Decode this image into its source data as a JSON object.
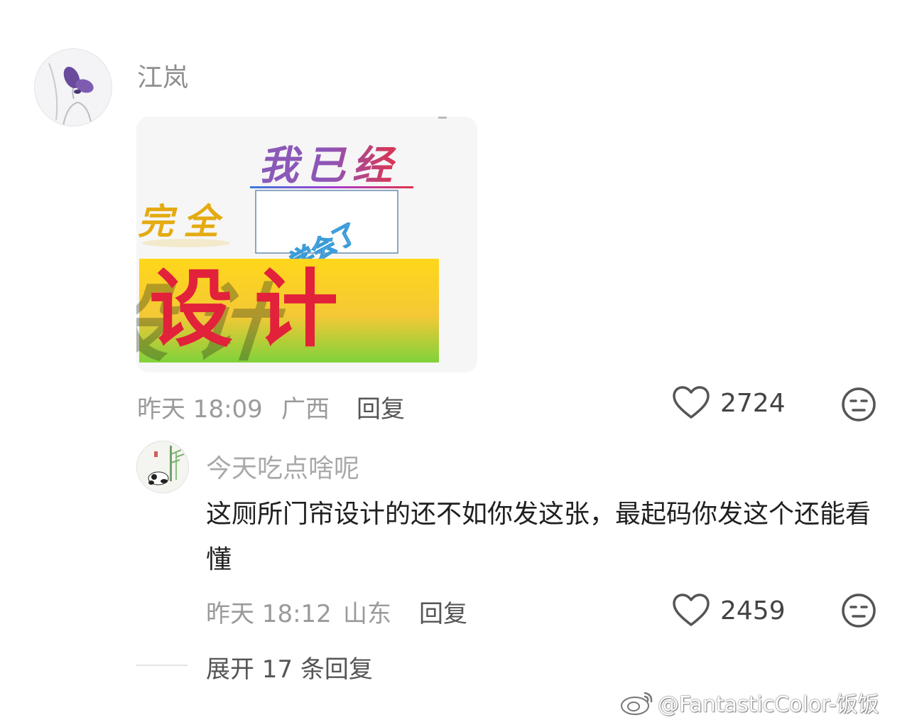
{
  "comment": {
    "username": "江岚",
    "meme_text": {
      "line1": "我已经",
      "line2a": "完全",
      "line2b": "学会了",
      "line3": "设计"
    },
    "time": "昨天 18:09",
    "location": "广西",
    "reply_label": "回复",
    "likes": "2724"
  },
  "reply": {
    "username": "今天吃点啥呢",
    "text": "这厕所门帘设计的还不如你发这张，最起码你发这个还能看懂",
    "time": "昨天 18:12",
    "location": "山东",
    "reply_label": "回复",
    "likes": "2459"
  },
  "expand_label": "展开 17 条回复",
  "watermark": "@FantasticColor-饭饭",
  "icons": {
    "like": "heart-outline-icon",
    "dislike": "neutral-face-icon",
    "watermark": "weibo-logo-icon"
  },
  "colors": {
    "meta_gray": "#9a9a9a",
    "username_gray": "#8f8f8f",
    "text_dark": "#1f1f1f",
    "meme_red": "#e2213a",
    "meme_gold": "#e0a500"
  }
}
